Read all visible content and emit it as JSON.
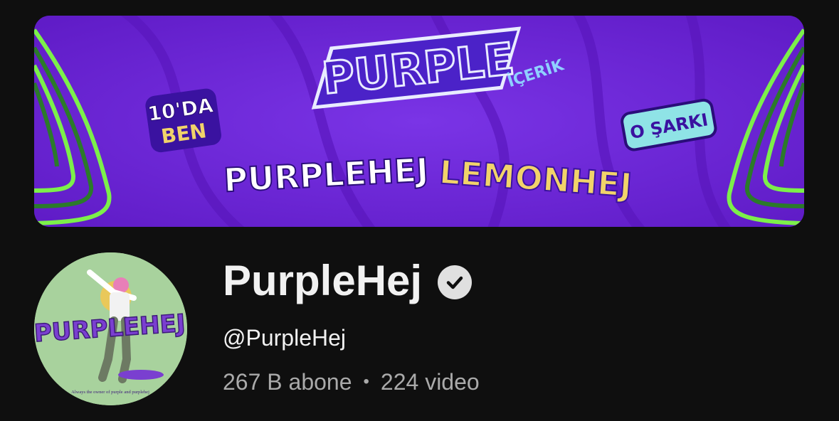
{
  "banner": {
    "logos": {
      "main": "PURPLE",
      "main_sub": "İÇERİK",
      "ten": "10'DA",
      "ben": "BEN",
      "purplehej": "PURPLEHEJ",
      "lemonhej": "LEMONHEJ",
      "osarki": "O ŞARKI"
    },
    "colors": {
      "background": "#6a22d6",
      "accent_green": "#7cf04a",
      "lemon": "#f1d36a"
    }
  },
  "avatar": {
    "text": "PURPLEHEJ",
    "caption": "Always the owner of purple and purplehej"
  },
  "channel": {
    "name": "PurpleHej",
    "verified_icon": "verified-check-icon",
    "handle": "@PurpleHej",
    "subscribers": "267 B abone",
    "separator": "•",
    "videos": "224 video"
  }
}
